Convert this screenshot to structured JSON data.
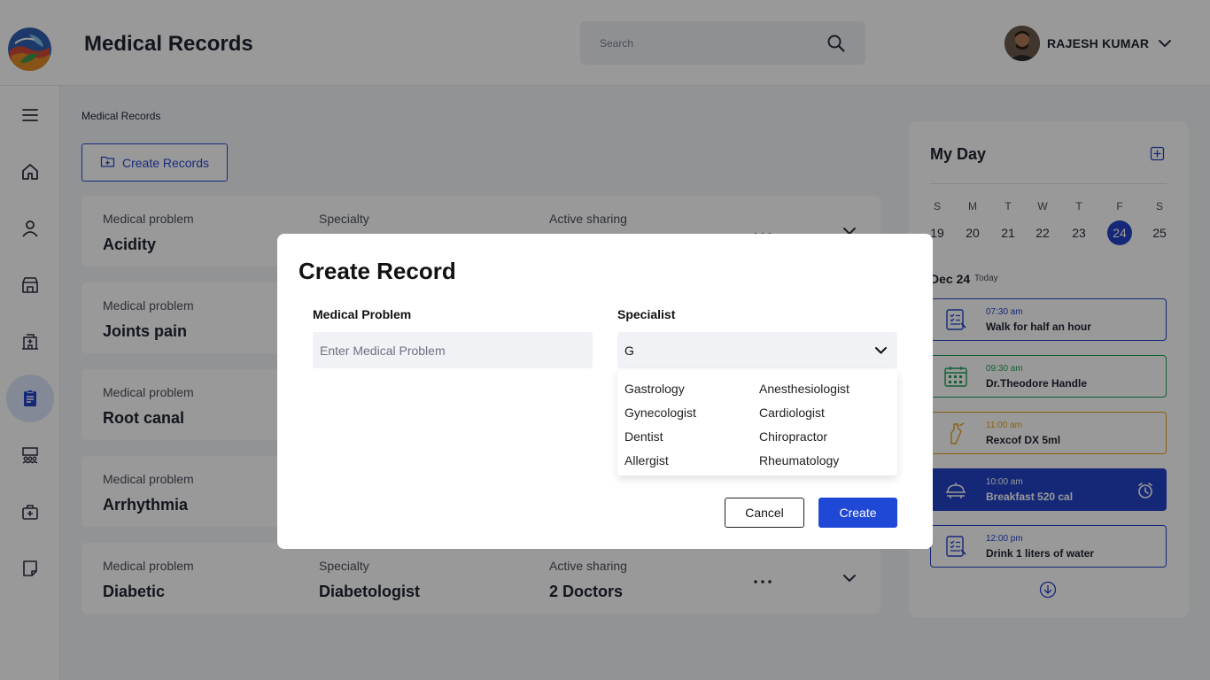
{
  "header": {
    "title": "Medical Records",
    "search_placeholder": "Search",
    "user_name": "RAJESH KUMAR"
  },
  "sidebar": {
    "items": [
      {
        "name": "menu-icon"
      },
      {
        "name": "home-icon"
      },
      {
        "name": "user-icon"
      },
      {
        "name": "store-icon"
      },
      {
        "name": "hospital-icon"
      },
      {
        "name": "clipboard-icon",
        "active": true
      },
      {
        "name": "presentation-icon"
      },
      {
        "name": "medical-kit-icon"
      },
      {
        "name": "note-icon"
      }
    ]
  },
  "main": {
    "breadcrumb": "Medical Records",
    "create_button_label": "Create Records",
    "records": [
      {
        "problem_label": "Medical problem",
        "problem": "Acidity",
        "specialty_label": "Specialty",
        "sharing_label": "Active sharing"
      },
      {
        "problem_label": "Medical problem",
        "problem": "Joints pain"
      },
      {
        "problem_label": "Medical problem",
        "problem": "Root canal"
      },
      {
        "problem_label": "Medical problem",
        "problem": "Arrhythmia"
      },
      {
        "problem_label": "Medical problem",
        "problem": "Diabetic",
        "specialty_label": "Specialty",
        "specialty": "Diabetologist",
        "sharing_label": "Active sharing",
        "sharing": "2 Doctors"
      }
    ]
  },
  "myday": {
    "title": "My Day",
    "weekdays": [
      "S",
      "M",
      "T",
      "W",
      "T",
      "F",
      "S"
    ],
    "dates": [
      "19",
      "20",
      "21",
      "22",
      "23",
      "24",
      "25"
    ],
    "selected_date": "24",
    "day_heading": "Dec 24",
    "day_tag": "Today",
    "events": [
      {
        "time": "07:30 am",
        "title": "Walk for half an hour",
        "icon": "checklist-icon",
        "color": "#2343c8",
        "bg": "#ffffff"
      },
      {
        "time": "09:30 am",
        "title": "Dr.Theodore Handle",
        "icon": "calendar-icon",
        "color": "#1e9e57",
        "bg": "#ffffff"
      },
      {
        "time": "11:00 am",
        "title": "Rexcof DX 5ml",
        "icon": "medicine-bottle-icon",
        "color": "#e8a21a",
        "bg": "#ffffff"
      },
      {
        "time": "10:00 am",
        "title": "Breakfast 520 cal",
        "icon": "meal-icon",
        "color": "#ffffff",
        "bg": "#2343c8"
      },
      {
        "time": "12:00 pm",
        "title": "Drink 1 liters of water",
        "icon": "checklist-icon",
        "color": "#2343c8",
        "bg": "#ffffff"
      }
    ]
  },
  "modal": {
    "title": "Create Record",
    "medical_problem_label": "Medical Problem",
    "medical_problem_placeholder": "Enter Medical Problem",
    "medical_problem_value": "",
    "specialist_label": "Specialist",
    "specialist_value": "G",
    "specialist_options": [
      "Gastrology",
      "Gynecologist",
      "Dentist",
      "Allergist",
      "Anesthesiologist",
      "Cardiologist",
      "Chiropractor",
      "Rheumatology"
    ],
    "cancel_label": "Cancel",
    "create_label": "Create"
  },
  "colors": {
    "accent": "#1f48d6",
    "overlay": "rgba(0,0,0,0.40)"
  }
}
